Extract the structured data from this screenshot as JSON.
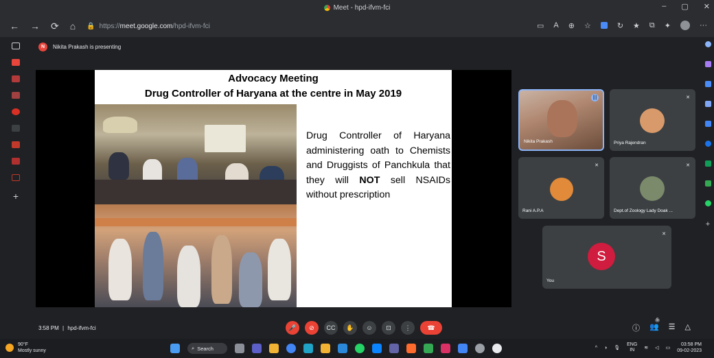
{
  "window": {
    "tab_title": "Meet - hpd-ifvm-fci",
    "minimize": "–",
    "restore": "▢",
    "close": "✕"
  },
  "browser": {
    "back": "←",
    "forward": "→",
    "reload": "⟳",
    "home": "⌂",
    "url_scheme": "https://",
    "url_host": "meet.google.com",
    "url_path": "/hpd-ifvm-fci",
    "more": "···"
  },
  "meet": {
    "presenting_initial": "N",
    "presenting_text": "Nikita Prakash is presenting",
    "slide": {
      "title": "Advocacy Meeting",
      "subtitle": "Drug Controller of Haryana at the centre in May 2019",
      "body_pre": "Drug Controller of Haryana administering oath to Chemists and Druggists of Panchkula that they will ",
      "body_bold": "NOT",
      "body_post": " sell NSAIDs without prescription"
    },
    "participants": [
      {
        "name": "Nikita Prakash"
      },
      {
        "name": "Priya Rajendran"
      },
      {
        "name": "Rani A.P.A"
      },
      {
        "name": "Dept.of Zoology Lady Doak ..."
      },
      {
        "name": "You",
        "initial": "S"
      }
    ],
    "clock": "3:58 PM",
    "separator": "|",
    "meeting_code": "hpd-ifvm-fci",
    "icons": {
      "mic_off": "🎤",
      "cam_off": "⊘",
      "captions": "CC",
      "hand": "✋",
      "emoji": "☺",
      "present": "⊡",
      "more": "⋮",
      "end_call": "☎",
      "info": "ⓘ",
      "people": "👥",
      "chat": "☰",
      "activities": "△",
      "speaking": "|||"
    },
    "people_count": "5"
  },
  "taskbar": {
    "temp": "90°F",
    "weather": "Mostly sunny",
    "search": "Search",
    "lang": "ENG",
    "region": "IN",
    "time": "03:58 PM",
    "date": "09-02-2023"
  }
}
